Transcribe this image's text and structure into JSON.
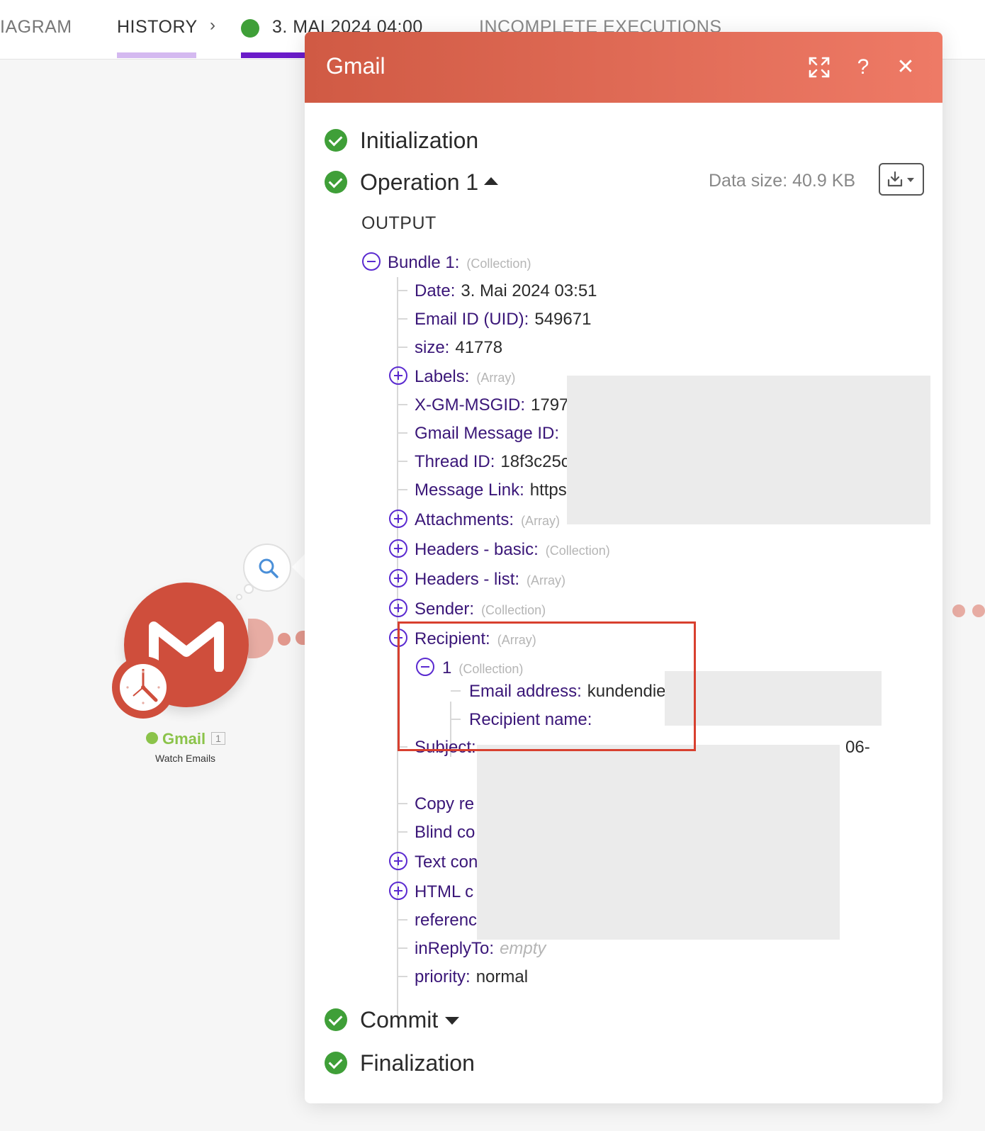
{
  "tabs": {
    "diagram": "IAGRAM",
    "history": "HISTORY",
    "run": "3. MAI 2024 04:00",
    "incomplete": "INCOMPLETE EXECUTIONS"
  },
  "module": {
    "name": "Gmail",
    "count": "1",
    "action": "Watch Emails"
  },
  "panel": {
    "title": "Gmail",
    "phases": {
      "initialization": "Initialization",
      "operation": "Operation 1",
      "commit": "Commit",
      "finalization": "Finalization"
    },
    "data_size": "Data size: 40.9 KB",
    "output_label": "OUTPUT"
  },
  "bundle": {
    "key": "Bundle 1:",
    "type": "(Collection)",
    "rows": {
      "date_k": "Date:",
      "date_v": "3. Mai 2024 03:51",
      "uid_k": "Email ID (UID):",
      "uid_v": "549671",
      "size_k": "size:",
      "size_v": "41778",
      "labels_k": "Labels:",
      "labels_t": "(Array)",
      "msgid_k": "X-GM-MSGID:",
      "msgid_v": "1797",
      "gmid_k": "Gmail Message ID:",
      "thread_k": "Thread ID:",
      "thread_v": "18f3c25c",
      "link_k": "Message Link:",
      "link_v": "https",
      "attach_k": "Attachments:",
      "attach_t": "(Array)",
      "hbasic_k": "Headers - basic:",
      "hbasic_t": "(Collection)",
      "hlist_k": "Headers - list:",
      "hlist_t": "(Array)",
      "sender_k": "Sender:",
      "sender_t": "(Collection)",
      "recipient_k": "Recipient:",
      "recipient_t": "(Array)",
      "r1_k": "1",
      "r1_t": "(Collection)",
      "email_k": "Email address:",
      "email_v": "kundendie",
      "rname_k": "Recipient name:",
      "subject_k": "Subject:",
      "subject_v": "06-",
      "copy_k": "Copy re",
      "blind_k": "Blind co",
      "text_k": "Text con",
      "html_k": "HTML c",
      "ref_k": "referenc",
      "inreply_k": "inReplyTo:",
      "inreply_v": "empty",
      "priority_k": "priority:",
      "priority_v": "normal"
    }
  },
  "colors": {
    "accent": "#6a1bc9",
    "header_start": "#d05a44",
    "header_end": "#ee7a66",
    "success": "#3f9f38",
    "key_text": "#3a1678",
    "highlight": "#d8402f"
  },
  "icons": [
    "expand-icon",
    "help-icon",
    "close-icon",
    "download-icon",
    "search-icon",
    "gmail-icon",
    "clock-icon",
    "check-icon"
  ]
}
